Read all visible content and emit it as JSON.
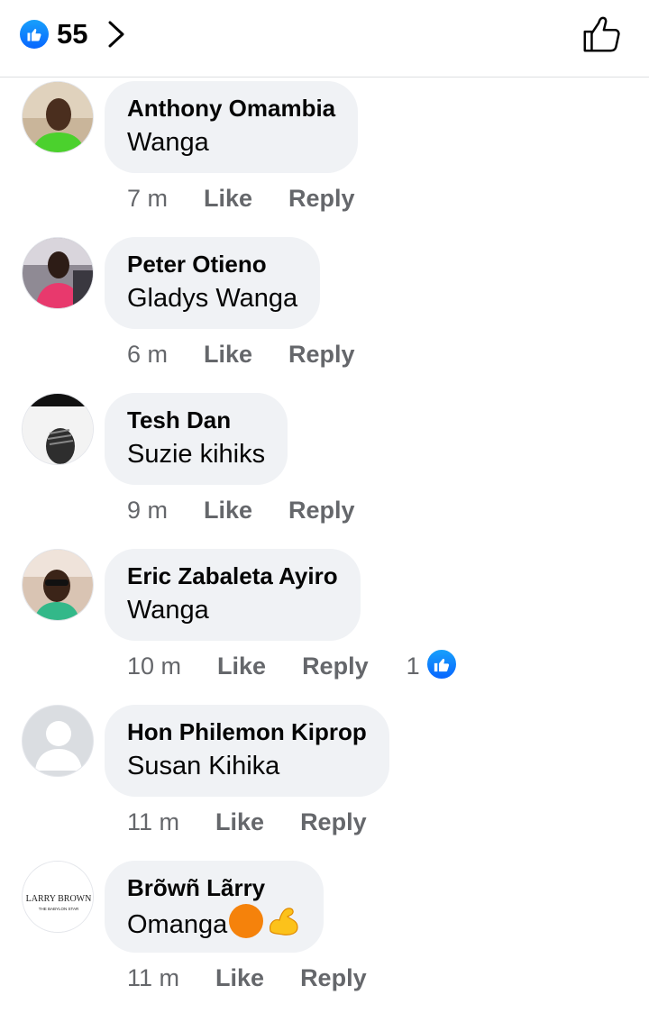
{
  "header": {
    "reaction_count": "55",
    "reaction_icon": "like-icon",
    "colors": {
      "like_blue": "#0866ff",
      "divider": "#dddfe2"
    }
  },
  "comments": [
    {
      "author": "Anthony Omambia",
      "text": "Wanga",
      "time": "7 m",
      "like": "Like",
      "reply": "Reply",
      "avatar": "photo-green-shirt"
    },
    {
      "author": "Peter Otieno",
      "text": "Gladys Wanga",
      "time": "6 m",
      "like": "Like",
      "reply": "Reply",
      "avatar": "photo-car"
    },
    {
      "author": "Tesh Dan",
      "text": "Suzie kihiks",
      "time": "9 m",
      "like": "Like",
      "reply": "Reply",
      "avatar": "photo-braids-bw"
    },
    {
      "author": "Eric Zabaleta Ayiro",
      "text": "Wanga",
      "time": "10 m",
      "like": "Like",
      "reply": "Reply",
      "reaction_count": "1",
      "avatar": "photo-sunglasses"
    },
    {
      "author": "Hon Philemon Kiprop",
      "text": "Susan Kihika",
      "time": "11 m",
      "like": "Like",
      "reply": "Reply",
      "avatar": "default-silhouette"
    },
    {
      "author": "Brõwñ Lãrry",
      "text": "Omanga",
      "text_emoji": [
        "orange-circle-emoji",
        "flexed-biceps-emoji"
      ],
      "time": "11 m",
      "like": "Like",
      "reply": "Reply",
      "avatar": "logo-larry-brown",
      "avatar_text": "LARRY BROWN",
      "avatar_subtext": "THE BABYLON STAR"
    }
  ]
}
